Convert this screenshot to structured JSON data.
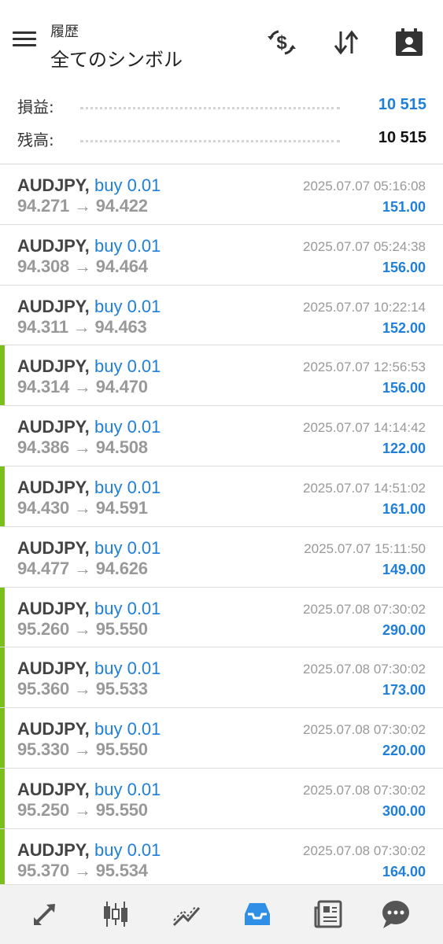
{
  "header": {
    "subtitle": "履歴",
    "title": "全てのシンボル",
    "icons": [
      "menu-icon",
      "currency-exchange-icon",
      "sort-icon",
      "account-report-icon"
    ]
  },
  "summary": {
    "profit_label": "損益:",
    "profit_value": "10 515",
    "balance_label": "残高:",
    "balance_value": "10 515"
  },
  "trades": [
    {
      "symbol": "AUDJPY,",
      "side": "buy 0.01",
      "prices": "94.271 → 94.422",
      "time": "2025.07.07 05:16:08",
      "profit": "151.00",
      "accent": false
    },
    {
      "symbol": "AUDJPY,",
      "side": "buy 0.01",
      "prices": "94.308 → 94.464",
      "time": "2025.07.07 05:24:38",
      "profit": "156.00",
      "accent": false
    },
    {
      "symbol": "AUDJPY,",
      "side": "buy 0.01",
      "prices": "94.311 → 94.463",
      "time": "2025.07.07 10:22:14",
      "profit": "152.00",
      "accent": false
    },
    {
      "symbol": "AUDJPY,",
      "side": "buy 0.01",
      "prices": "94.314 → 94.470",
      "time": "2025.07.07 12:56:53",
      "profit": "156.00",
      "accent": true
    },
    {
      "symbol": "AUDJPY,",
      "side": "buy 0.01",
      "prices": "94.386 → 94.508",
      "time": "2025.07.07 14:14:42",
      "profit": "122.00",
      "accent": false
    },
    {
      "symbol": "AUDJPY,",
      "side": "buy 0.01",
      "prices": "94.430 → 94.591",
      "time": "2025.07.07 14:51:02",
      "profit": "161.00",
      "accent": true
    },
    {
      "symbol": "AUDJPY,",
      "side": "buy 0.01",
      "prices": "94.477 → 94.626",
      "time": "2025.07.07 15:11:50",
      "profit": "149.00",
      "accent": false
    },
    {
      "symbol": "AUDJPY,",
      "side": "buy 0.01",
      "prices": "95.260 → 95.550",
      "time": "2025.07.08 07:30:02",
      "profit": "290.00",
      "accent": true
    },
    {
      "symbol": "AUDJPY,",
      "side": "buy 0.01",
      "prices": "95.360 → 95.533",
      "time": "2025.07.08 07:30:02",
      "profit": "173.00",
      "accent": true
    },
    {
      "symbol": "AUDJPY,",
      "side": "buy 0.01",
      "prices": "95.330 → 95.550",
      "time": "2025.07.08 07:30:02",
      "profit": "220.00",
      "accent": true
    },
    {
      "symbol": "AUDJPY,",
      "side": "buy 0.01",
      "prices": "95.250 → 95.550",
      "time": "2025.07.08 07:30:02",
      "profit": "300.00",
      "accent": true
    },
    {
      "symbol": "AUDJPY,",
      "side": "buy 0.01",
      "prices": "95.370 → 95.534",
      "time": "2025.07.08 07:30:02",
      "profit": "164.00",
      "accent": true
    }
  ],
  "bottom_nav": {
    "items": [
      "quotes-icon",
      "chart-icon",
      "trade-icon",
      "history-icon",
      "news-icon",
      "messages-icon"
    ],
    "active": "history-icon"
  },
  "colors": {
    "accent_blue": "#1f7fd9",
    "profit_green": "#7bbf1e",
    "muted_text": "#999999"
  }
}
